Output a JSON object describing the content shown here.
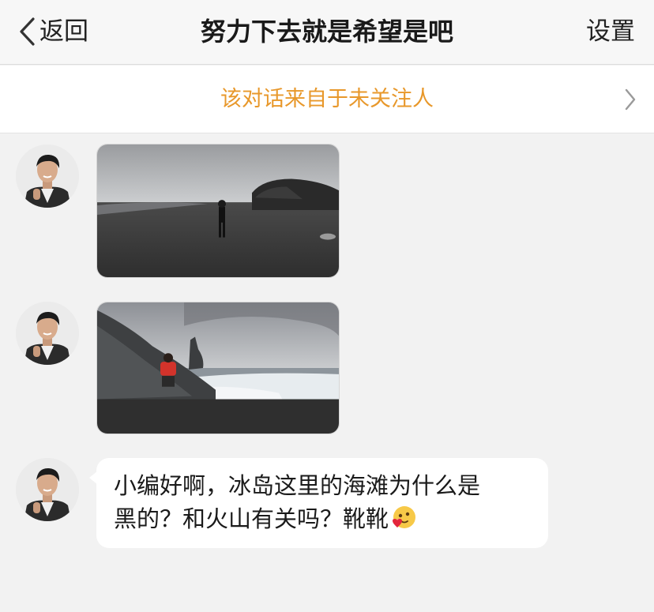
{
  "header": {
    "back_label": "返回",
    "title": "努力下去就是希望是吧",
    "settings_label": "设置"
  },
  "notice": {
    "text": "该对话来自于未关注人"
  },
  "messages": [
    {
      "type": "image",
      "description_icon": "photo-black-sand-beach"
    },
    {
      "type": "image",
      "description_icon": "photo-rocky-shore"
    },
    {
      "type": "text",
      "line1": "小编好啊，冰岛这里的海滩为什么是",
      "line2": "黑的？和火山有关吗？靴靴",
      "emoji": "smiling-face-with-heart-icon"
    }
  ],
  "colors": {
    "notice_text": "#e8982b",
    "background": "#f2f2f2",
    "bubble": "#ffffff"
  }
}
